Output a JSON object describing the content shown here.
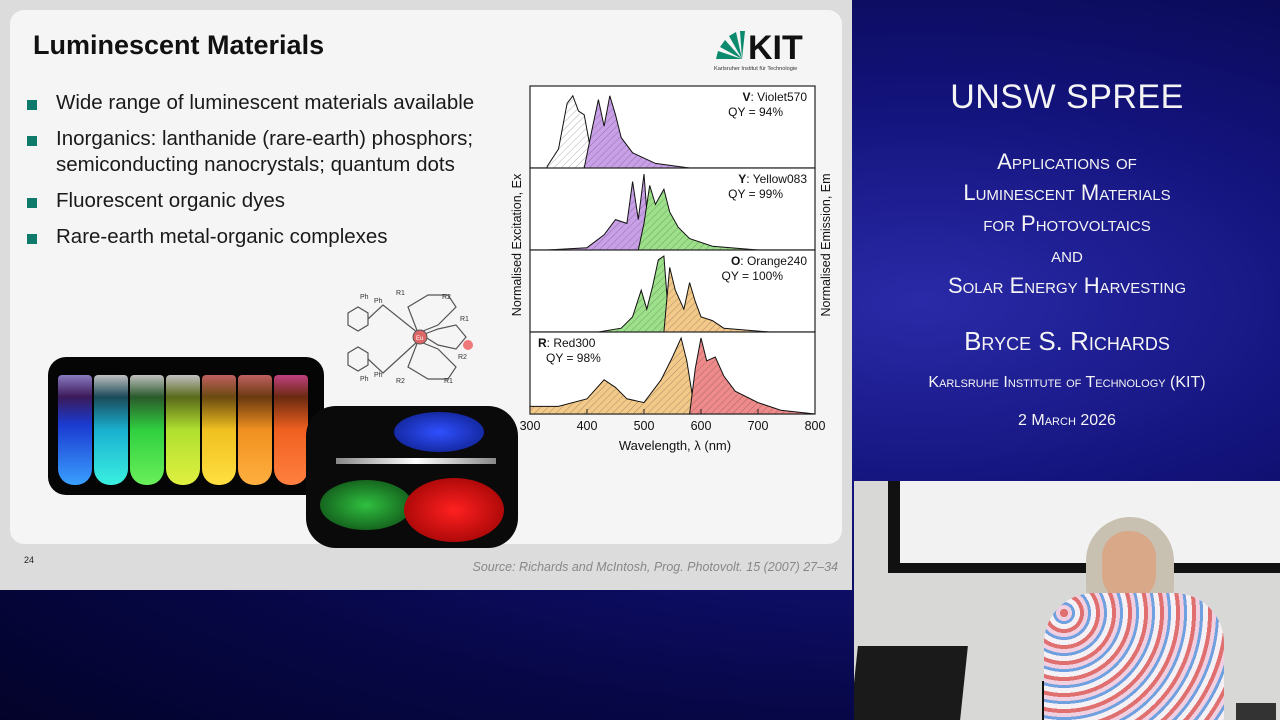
{
  "slide": {
    "title": "Luminescent Materials",
    "logo": {
      "text": "KIT",
      "subtitle": "Karlsruher Institut für Technologie"
    },
    "bullets": [
      "Wide range of luminescent materials available",
      "Inorganics:  lanthanide (rare-earth) phosphors;  semiconducting nanocrystals;  quantum dots",
      "Fluorescent organic dyes",
      "Rare-earth metal-organic complexes"
    ],
    "slide_number": "24",
    "source": "Source:   Richards and McIntosh, Prog. Photovolt. 15 (2007) 27–34",
    "molecule_labels": {
      "ph": "Ph",
      "r1": "R1",
      "r2": "R2",
      "center": "Eu",
      "o": "O"
    }
  },
  "chart_data": {
    "type": "area",
    "xlabel": "Wavelength, λ (nm)",
    "ylabel_left": "Normalised Excitation, Ex",
    "ylabel_right": "Normalised Emission, Em",
    "xlim": [
      300,
      800
    ],
    "xticks": [
      300,
      400,
      500,
      600,
      700,
      800
    ],
    "panels": [
      {
        "letter": "V",
        "name": "Violet570",
        "qy": "QY = 94%",
        "excitation": {
          "color": "#ffffff",
          "x": [
            330,
            350,
            365,
            375,
            385,
            395,
            405,
            420,
            440
          ],
          "y": [
            0.02,
            0.25,
            0.85,
            0.95,
            0.75,
            0.7,
            0.3,
            0.05,
            0
          ]
        },
        "emission": {
          "color": "#c9a0e8",
          "x": [
            395,
            410,
            420,
            430,
            440,
            450,
            460,
            480,
            520,
            580
          ],
          "y": [
            0,
            0.55,
            0.9,
            0.55,
            0.95,
            0.7,
            0.4,
            0.2,
            0.06,
            0
          ]
        }
      },
      {
        "letter": "Y",
        "name": "Yellow083",
        "qy": "QY = 99%",
        "excitation": {
          "color": "#c9a0e8",
          "x": [
            330,
            400,
            430,
            450,
            470,
            480,
            490,
            500,
            510
          ],
          "y": [
            0,
            0.03,
            0.2,
            0.4,
            0.35,
            0.9,
            0.4,
            1.0,
            0
          ]
        },
        "emission": {
          "color": "#9de08a",
          "x": [
            490,
            500,
            510,
            520,
            535,
            545,
            560,
            580,
            620,
            700
          ],
          "y": [
            0,
            0.35,
            0.85,
            0.6,
            0.8,
            0.5,
            0.3,
            0.15,
            0.05,
            0
          ]
        }
      },
      {
        "letter": "O",
        "name": "Orange240",
        "qy": "QY = 100%",
        "excitation": {
          "color": "#9de08a",
          "x": [
            420,
            460,
            480,
            495,
            505,
            515,
            525,
            535,
            545
          ],
          "y": [
            0,
            0.05,
            0.2,
            0.55,
            0.3,
            0.6,
            0.95,
            1.0,
            0
          ]
        },
        "emission": {
          "color": "#f3c98a",
          "x": [
            535,
            545,
            555,
            570,
            580,
            590,
            600,
            620,
            640,
            720
          ],
          "y": [
            0,
            0.85,
            0.55,
            0.3,
            0.65,
            0.4,
            0.2,
            0.15,
            0.05,
            0
          ]
        }
      },
      {
        "letter": "R",
        "name": "Red300",
        "qy": "QY = 98%",
        "excitation": {
          "color": "#f3c98a",
          "x": [
            300,
            350,
            400,
            430,
            450,
            470,
            500,
            530,
            550,
            565,
            575,
            590
          ],
          "y": [
            0.1,
            0.1,
            0.2,
            0.45,
            0.35,
            0.2,
            0.15,
            0.45,
            0.75,
            1.0,
            0.7,
            0
          ]
        },
        "emission": {
          "color": "#ef8a8a",
          "x": [
            580,
            590,
            600,
            610,
            625,
            640,
            660,
            700,
            740,
            800
          ],
          "y": [
            0,
            0.6,
            1.0,
            0.7,
            0.75,
            0.5,
            0.3,
            0.15,
            0.05,
            0
          ]
        }
      }
    ]
  },
  "right_panel": {
    "main_title": "UNSW SPREE",
    "subtitle_lines": [
      "Applications of",
      "Luminescent Materials",
      "for Photovoltaics",
      "and",
      "Solar Energy Harvesting"
    ],
    "presenter": "Bryce S. Richards",
    "affiliation": "Karlsruhe Institute of Technology (KIT)",
    "date": "2 March 2026"
  },
  "colors": {
    "bullet": "#0d7a6a",
    "kit_green": "#0c8a6e",
    "background": "#0a0a55"
  }
}
